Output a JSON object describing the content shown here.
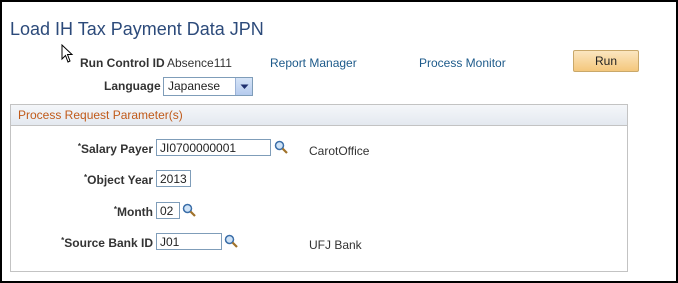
{
  "page": {
    "title": "Load IH Tax Payment Data JPN"
  },
  "header": {
    "run_control_label": "Run Control ID",
    "run_control_value": "Absence111",
    "report_manager": "Report Manager",
    "process_monitor": "Process Monitor",
    "run_button": "Run",
    "language_label": "Language",
    "language_value": "Japanese"
  },
  "params": {
    "group_title": "Process Request Parameter(s)",
    "salary_payer": {
      "label": "Salary Payer",
      "value": "JI0700000001",
      "desc": "CarotOffice"
    },
    "object_year": {
      "label": "Object Year",
      "value": "2013"
    },
    "month": {
      "label": "Month",
      "value": "02"
    },
    "source_bank": {
      "label": "Source Bank ID",
      "value": "J01",
      "desc": "UFJ Bank"
    },
    "required_marker": "*"
  },
  "colors": {
    "title": "#2c4a7a",
    "link": "#1d5a8a",
    "group_title": "#c05a1a",
    "run_button": "#f4c77c"
  },
  "icons": {
    "lookup": "magnifier-icon",
    "cursor": "mouse-pointer-icon",
    "dropdown": "chevron-down-icon"
  }
}
